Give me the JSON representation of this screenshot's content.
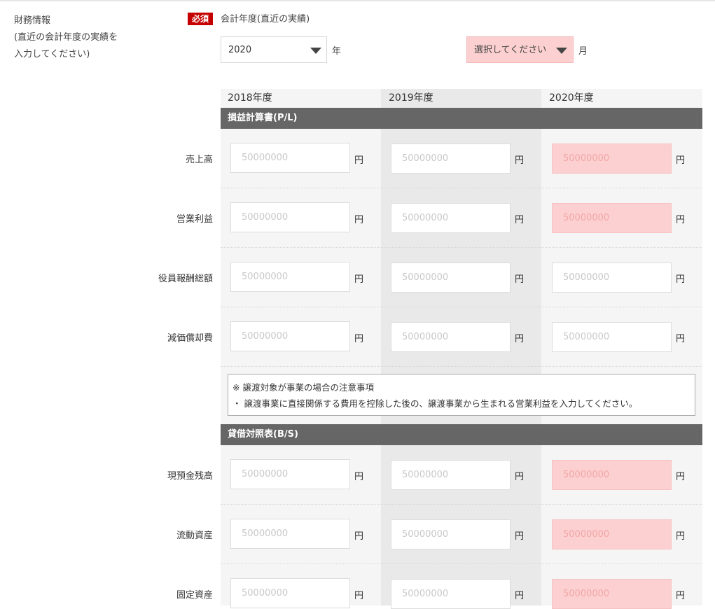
{
  "section": {
    "title": "財務情報",
    "subtitle_line1": "(直近の会計年度の実績を",
    "subtitle_line2": "入力してください)",
    "required_badge": "必須",
    "fiscal_year_label": "会計年度(直近の実績)"
  },
  "fiscal_year_select": {
    "value": "2020",
    "unit": "年"
  },
  "fiscal_month_select": {
    "value": "選択してください",
    "unit": "月"
  },
  "columns": [
    "2018年度",
    "2019年度",
    "2020年度"
  ],
  "pl": {
    "title": "損益計算書(P/L)",
    "rows": [
      {
        "label": "売上高",
        "values": [
          "",
          "",
          ""
        ],
        "placeholder": "50000000",
        "unit": "円"
      },
      {
        "label": "営業利益",
        "values": [
          "",
          "",
          ""
        ],
        "placeholder": "50000000",
        "unit": "円"
      },
      {
        "label": "役員報酬総額",
        "values": [
          "",
          "",
          ""
        ],
        "placeholder": "50000000",
        "unit": "円"
      },
      {
        "label": "減価償却費",
        "values": [
          "",
          "",
          ""
        ],
        "placeholder": "50000000",
        "unit": "円"
      }
    ]
  },
  "note": {
    "heading": "※ 譲渡対象が事業の場合の注意事項",
    "body": "・ 譲渡事業に直接関係する費用を控除した後の、譲渡事業から生まれる営業利益を入力してください。"
  },
  "bs": {
    "title": "貸借対照表(B/S)",
    "rows": [
      {
        "label": "現預金残高",
        "values": [
          "",
          "",
          ""
        ],
        "placeholder": "50000000",
        "unit": "円"
      },
      {
        "label": "流動資産",
        "values": [
          "",
          "",
          ""
        ],
        "placeholder": "50000000",
        "unit": "円"
      },
      {
        "label": "固定資産",
        "values": [
          "",
          "",
          ""
        ],
        "placeholder": "50000000",
        "unit": "円"
      }
    ]
  },
  "colors": {
    "required_red": "#c40000",
    "error_pink": "#fcd0d0",
    "section_bar": "#666666"
  }
}
